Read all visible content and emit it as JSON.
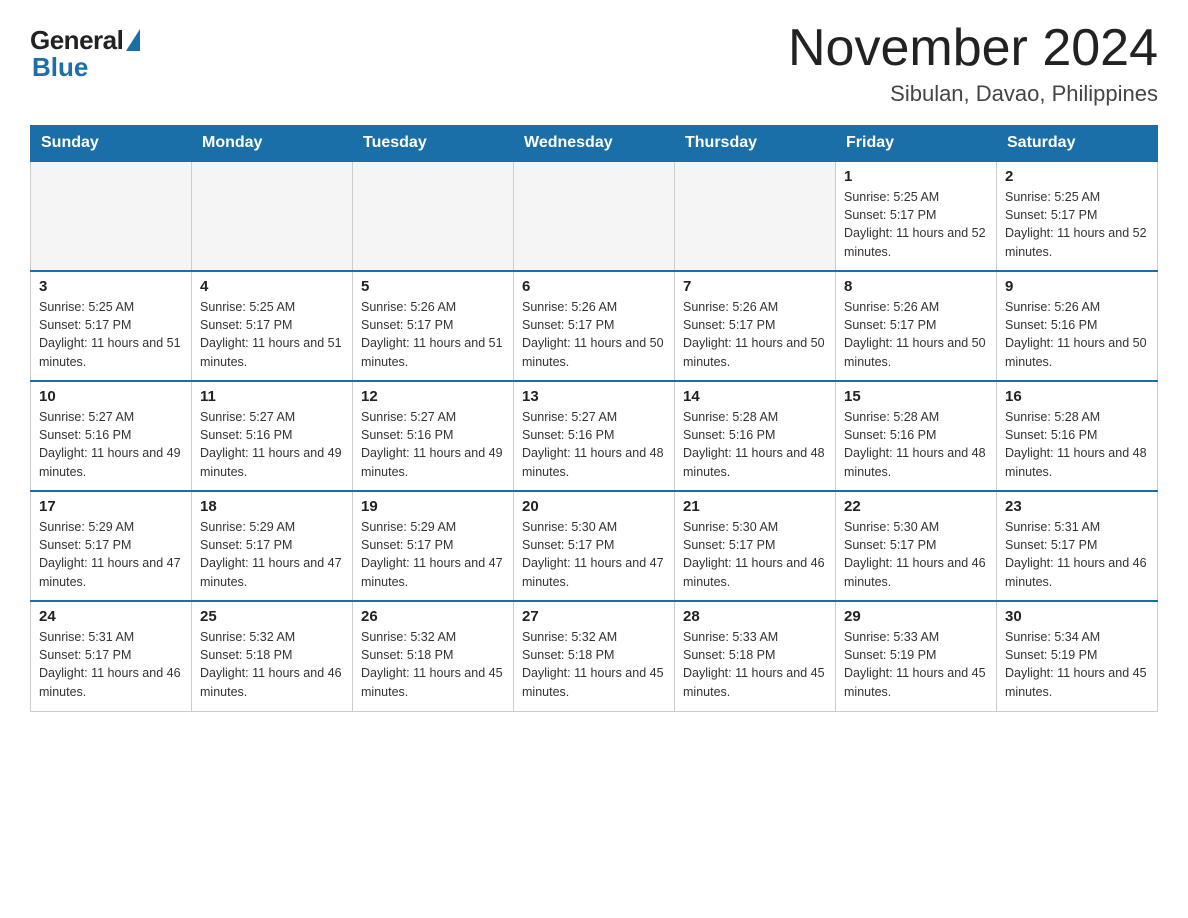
{
  "header": {
    "logo_general": "General",
    "logo_blue": "Blue",
    "month_title": "November 2024",
    "location": "Sibulan, Davao, Philippines"
  },
  "weekdays": [
    "Sunday",
    "Monday",
    "Tuesday",
    "Wednesday",
    "Thursday",
    "Friday",
    "Saturday"
  ],
  "weeks": [
    [
      {
        "day": "",
        "empty": true
      },
      {
        "day": "",
        "empty": true
      },
      {
        "day": "",
        "empty": true
      },
      {
        "day": "",
        "empty": true
      },
      {
        "day": "",
        "empty": true
      },
      {
        "day": "1",
        "sunrise": "Sunrise: 5:25 AM",
        "sunset": "Sunset: 5:17 PM",
        "daylight": "Daylight: 11 hours and 52 minutes."
      },
      {
        "day": "2",
        "sunrise": "Sunrise: 5:25 AM",
        "sunset": "Sunset: 5:17 PM",
        "daylight": "Daylight: 11 hours and 52 minutes."
      }
    ],
    [
      {
        "day": "3",
        "sunrise": "Sunrise: 5:25 AM",
        "sunset": "Sunset: 5:17 PM",
        "daylight": "Daylight: 11 hours and 51 minutes."
      },
      {
        "day": "4",
        "sunrise": "Sunrise: 5:25 AM",
        "sunset": "Sunset: 5:17 PM",
        "daylight": "Daylight: 11 hours and 51 minutes."
      },
      {
        "day": "5",
        "sunrise": "Sunrise: 5:26 AM",
        "sunset": "Sunset: 5:17 PM",
        "daylight": "Daylight: 11 hours and 51 minutes."
      },
      {
        "day": "6",
        "sunrise": "Sunrise: 5:26 AM",
        "sunset": "Sunset: 5:17 PM",
        "daylight": "Daylight: 11 hours and 50 minutes."
      },
      {
        "day": "7",
        "sunrise": "Sunrise: 5:26 AM",
        "sunset": "Sunset: 5:17 PM",
        "daylight": "Daylight: 11 hours and 50 minutes."
      },
      {
        "day": "8",
        "sunrise": "Sunrise: 5:26 AM",
        "sunset": "Sunset: 5:17 PM",
        "daylight": "Daylight: 11 hours and 50 minutes."
      },
      {
        "day": "9",
        "sunrise": "Sunrise: 5:26 AM",
        "sunset": "Sunset: 5:16 PM",
        "daylight": "Daylight: 11 hours and 50 minutes."
      }
    ],
    [
      {
        "day": "10",
        "sunrise": "Sunrise: 5:27 AM",
        "sunset": "Sunset: 5:16 PM",
        "daylight": "Daylight: 11 hours and 49 minutes."
      },
      {
        "day": "11",
        "sunrise": "Sunrise: 5:27 AM",
        "sunset": "Sunset: 5:16 PM",
        "daylight": "Daylight: 11 hours and 49 minutes."
      },
      {
        "day": "12",
        "sunrise": "Sunrise: 5:27 AM",
        "sunset": "Sunset: 5:16 PM",
        "daylight": "Daylight: 11 hours and 49 minutes."
      },
      {
        "day": "13",
        "sunrise": "Sunrise: 5:27 AM",
        "sunset": "Sunset: 5:16 PM",
        "daylight": "Daylight: 11 hours and 48 minutes."
      },
      {
        "day": "14",
        "sunrise": "Sunrise: 5:28 AM",
        "sunset": "Sunset: 5:16 PM",
        "daylight": "Daylight: 11 hours and 48 minutes."
      },
      {
        "day": "15",
        "sunrise": "Sunrise: 5:28 AM",
        "sunset": "Sunset: 5:16 PM",
        "daylight": "Daylight: 11 hours and 48 minutes."
      },
      {
        "day": "16",
        "sunrise": "Sunrise: 5:28 AM",
        "sunset": "Sunset: 5:16 PM",
        "daylight": "Daylight: 11 hours and 48 minutes."
      }
    ],
    [
      {
        "day": "17",
        "sunrise": "Sunrise: 5:29 AM",
        "sunset": "Sunset: 5:17 PM",
        "daylight": "Daylight: 11 hours and 47 minutes."
      },
      {
        "day": "18",
        "sunrise": "Sunrise: 5:29 AM",
        "sunset": "Sunset: 5:17 PM",
        "daylight": "Daylight: 11 hours and 47 minutes."
      },
      {
        "day": "19",
        "sunrise": "Sunrise: 5:29 AM",
        "sunset": "Sunset: 5:17 PM",
        "daylight": "Daylight: 11 hours and 47 minutes."
      },
      {
        "day": "20",
        "sunrise": "Sunrise: 5:30 AM",
        "sunset": "Sunset: 5:17 PM",
        "daylight": "Daylight: 11 hours and 47 minutes."
      },
      {
        "day": "21",
        "sunrise": "Sunrise: 5:30 AM",
        "sunset": "Sunset: 5:17 PM",
        "daylight": "Daylight: 11 hours and 46 minutes."
      },
      {
        "day": "22",
        "sunrise": "Sunrise: 5:30 AM",
        "sunset": "Sunset: 5:17 PM",
        "daylight": "Daylight: 11 hours and 46 minutes."
      },
      {
        "day": "23",
        "sunrise": "Sunrise: 5:31 AM",
        "sunset": "Sunset: 5:17 PM",
        "daylight": "Daylight: 11 hours and 46 minutes."
      }
    ],
    [
      {
        "day": "24",
        "sunrise": "Sunrise: 5:31 AM",
        "sunset": "Sunset: 5:17 PM",
        "daylight": "Daylight: 11 hours and 46 minutes."
      },
      {
        "day": "25",
        "sunrise": "Sunrise: 5:32 AM",
        "sunset": "Sunset: 5:18 PM",
        "daylight": "Daylight: 11 hours and 46 minutes."
      },
      {
        "day": "26",
        "sunrise": "Sunrise: 5:32 AM",
        "sunset": "Sunset: 5:18 PM",
        "daylight": "Daylight: 11 hours and 45 minutes."
      },
      {
        "day": "27",
        "sunrise": "Sunrise: 5:32 AM",
        "sunset": "Sunset: 5:18 PM",
        "daylight": "Daylight: 11 hours and 45 minutes."
      },
      {
        "day": "28",
        "sunrise": "Sunrise: 5:33 AM",
        "sunset": "Sunset: 5:18 PM",
        "daylight": "Daylight: 11 hours and 45 minutes."
      },
      {
        "day": "29",
        "sunrise": "Sunrise: 5:33 AM",
        "sunset": "Sunset: 5:19 PM",
        "daylight": "Daylight: 11 hours and 45 minutes."
      },
      {
        "day": "30",
        "sunrise": "Sunrise: 5:34 AM",
        "sunset": "Sunset: 5:19 PM",
        "daylight": "Daylight: 11 hours and 45 minutes."
      }
    ]
  ]
}
